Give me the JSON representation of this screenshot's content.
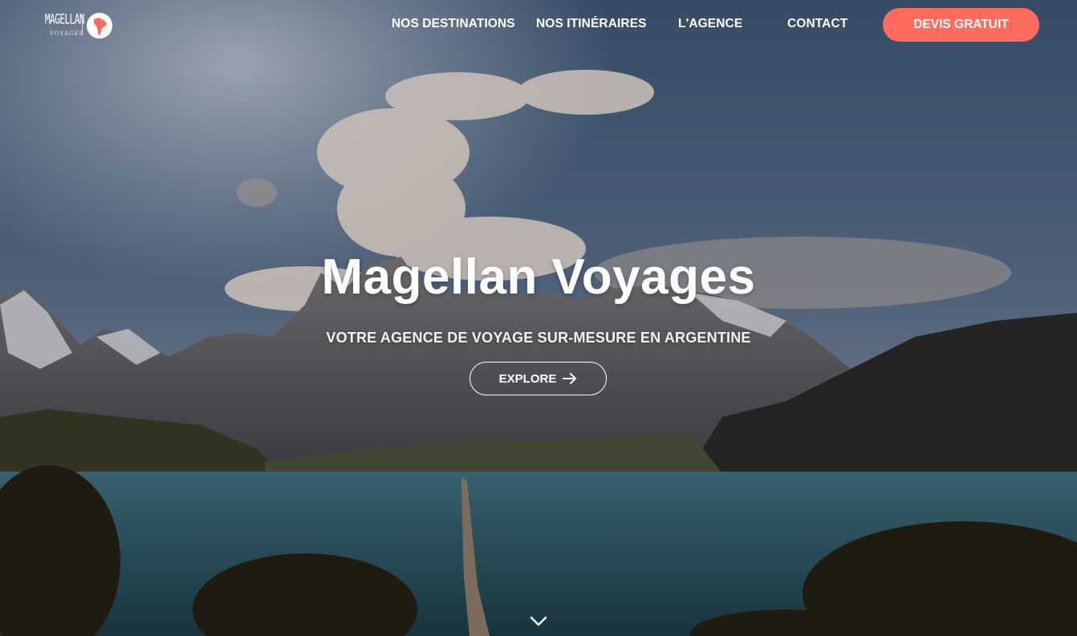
{
  "brand": {
    "logo_text": "MAGELLAN",
    "logo_sub": "VOYAGES",
    "accent_color": "#ff6b5e"
  },
  "nav": {
    "items": [
      {
        "label": "NOS DESTINATIONS"
      },
      {
        "label": "NOS ITINÉRAIRES"
      },
      {
        "label": "L'AGENCE"
      },
      {
        "label": "CONTACT"
      }
    ],
    "cta_label": "DEVIS GRATUIT"
  },
  "hero": {
    "title": "Magellan Voyages",
    "subtitle": "VOTRE AGENCE DE VOYAGE SUR-MESURE EN ARGENTINE",
    "button_label": "EXPLORE",
    "button_icon": "arrow-right-icon",
    "scroll_icon": "chevron-down-icon"
  }
}
